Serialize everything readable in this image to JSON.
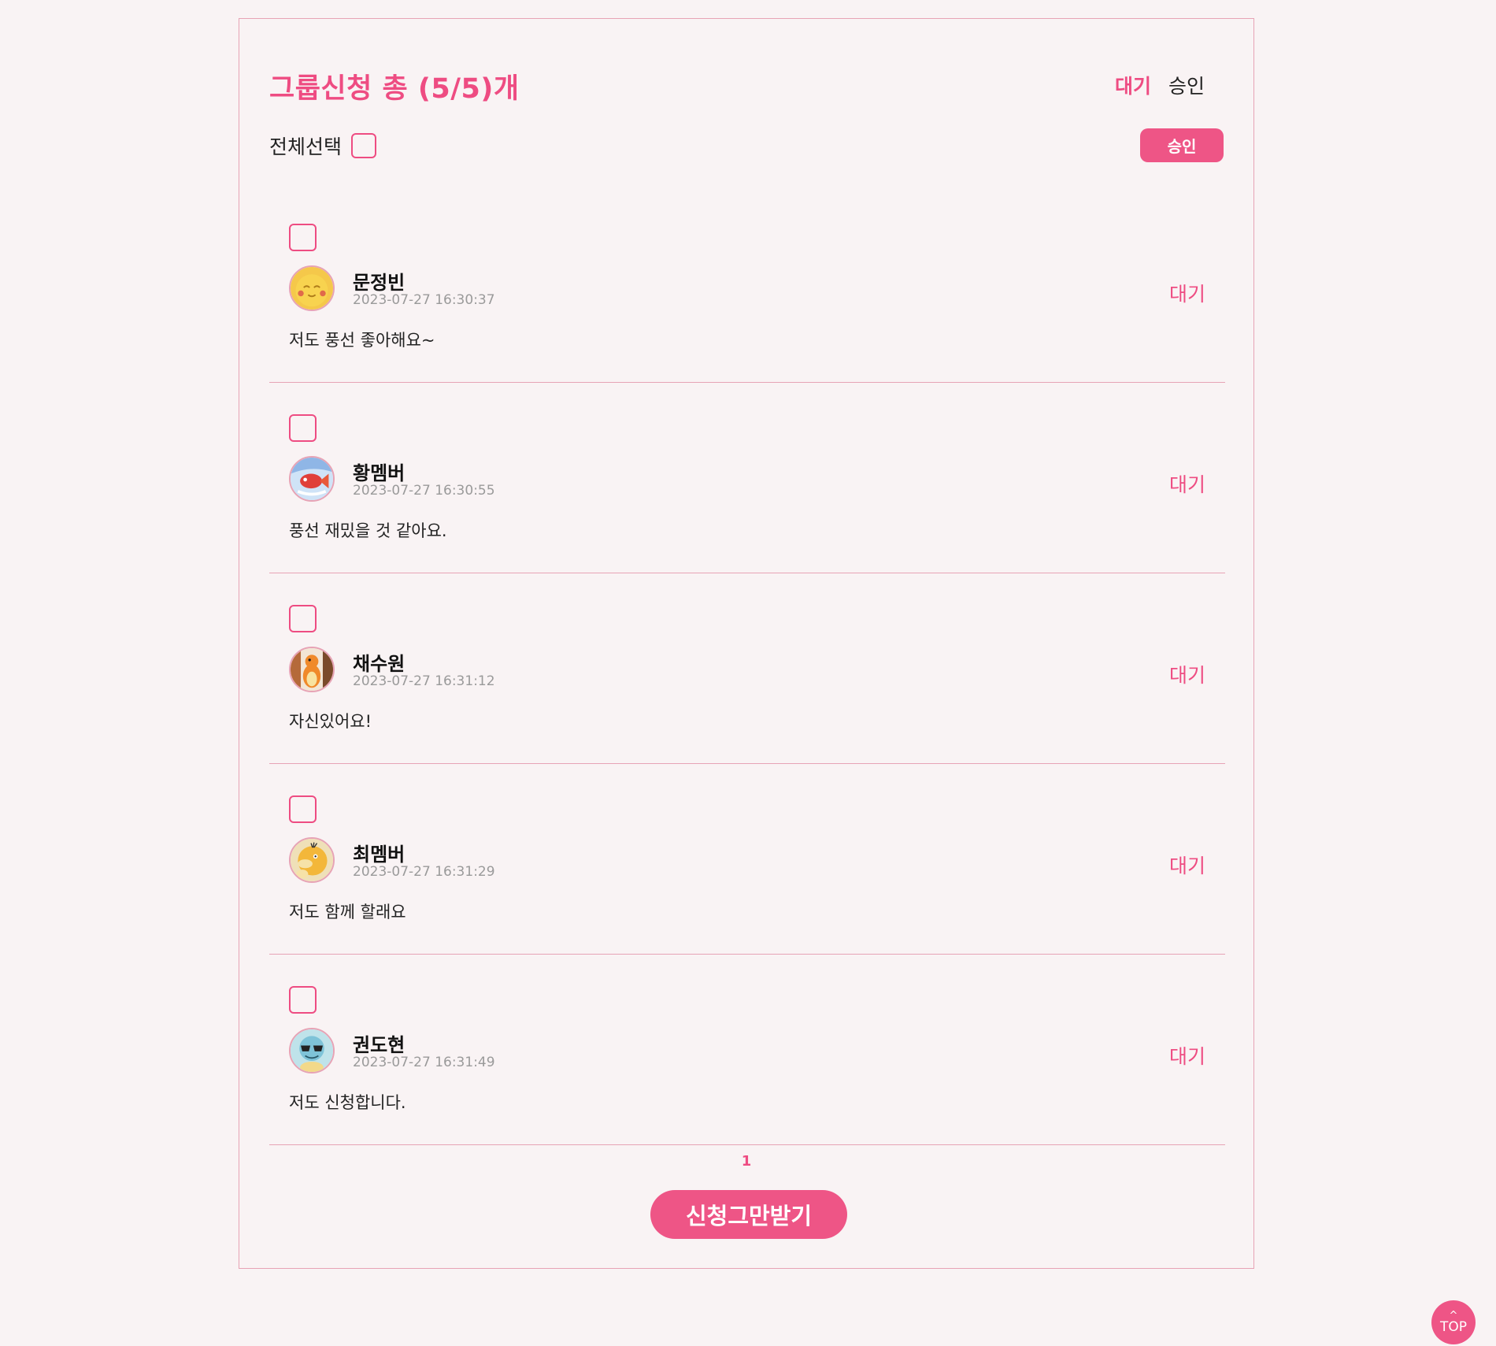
{
  "header": {
    "title": "그룹신청 총 (5/5)개",
    "filter_tabs": [
      {
        "label": "대기",
        "active": true
      },
      {
        "label": "승인",
        "active": false
      }
    ]
  },
  "toolbar": {
    "select_all_label": "전체선택",
    "approve_label": "승인"
  },
  "applications": [
    {
      "name": "문정빈",
      "date": "2023-07-27 16:30:37",
      "message": "저도 풍선 좋아해요~",
      "status": "대기",
      "avatar": "yellow-duck-avatar"
    },
    {
      "name": "황멤버",
      "date": "2023-07-27 16:30:55",
      "message": "풍선 재밌을 것 같아요.",
      "status": "대기",
      "avatar": "red-fish-avatar"
    },
    {
      "name": "채수원",
      "date": "2023-07-27 16:31:12",
      "message": "자신있어요!",
      "status": "대기",
      "avatar": "orange-lizard-avatar"
    },
    {
      "name": "최멤버",
      "date": "2023-07-27 16:31:29",
      "message": "저도 함께 할래요",
      "status": "대기",
      "avatar": "yellow-duck-psyduck-avatar"
    },
    {
      "name": "권도현",
      "date": "2023-07-27 16:31:49",
      "message": "저도 신청합니다.",
      "status": "대기",
      "avatar": "blue-turtle-avatar"
    }
  ],
  "pagination": {
    "current_page": "1"
  },
  "footer": {
    "stop_label": "신청그만받기",
    "top_caret": "^",
    "top_label": "TOP"
  },
  "colors": {
    "accent": "#ee4c82",
    "background": "#f9f3f4",
    "border": "#e7a3b5",
    "muted": "#9a9a9a"
  }
}
